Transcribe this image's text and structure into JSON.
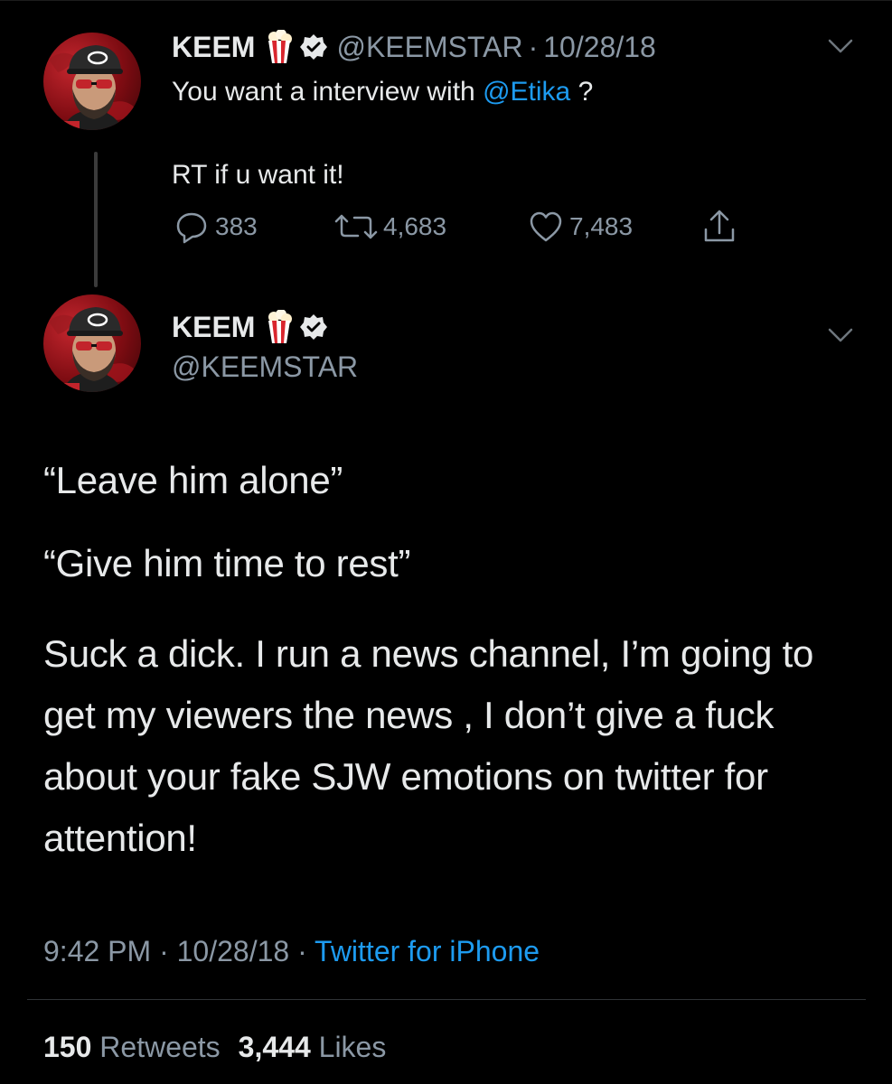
{
  "colors": {
    "background": "#000000",
    "text_primary": "#e7e9ea",
    "text_secondary": "#8b98a5",
    "link": "#1d9bf0",
    "thread_line": "#3b3b3b"
  },
  "tweet1": {
    "avatar_icon": "profile-avatar",
    "display_name": "KEEM",
    "name_emoji": "popcorn-icon",
    "verified_icon": "verified-badge-icon",
    "handle": "@KEEMSTAR",
    "separator": "·",
    "date": "10/28/18",
    "text_before_mention": "You want a interview with ",
    "mention": "@Etika",
    "text_after_mention": " ?",
    "text_line2": "RT if u want it!",
    "actions": {
      "replies": "383",
      "retweets": "4,683",
      "likes": "7,483"
    }
  },
  "tweet2": {
    "display_name": "KEEM",
    "handle": "@KEEMSTAR",
    "line1": "“Leave him alone”",
    "line2": "“Give him time to rest”",
    "paragraph": "Suck a dick. I run a news channel, I’m going to get my viewers the news , I don’t give a fuck about your fake SJW emotions on twitter for attention!",
    "time": "9:42 PM",
    "separator": "·",
    "date": "10/28/18",
    "source": "Twitter for iPhone",
    "retweets_count": "150",
    "retweets_label": "Retweets",
    "likes_count": "3,444",
    "likes_label": "Likes"
  }
}
